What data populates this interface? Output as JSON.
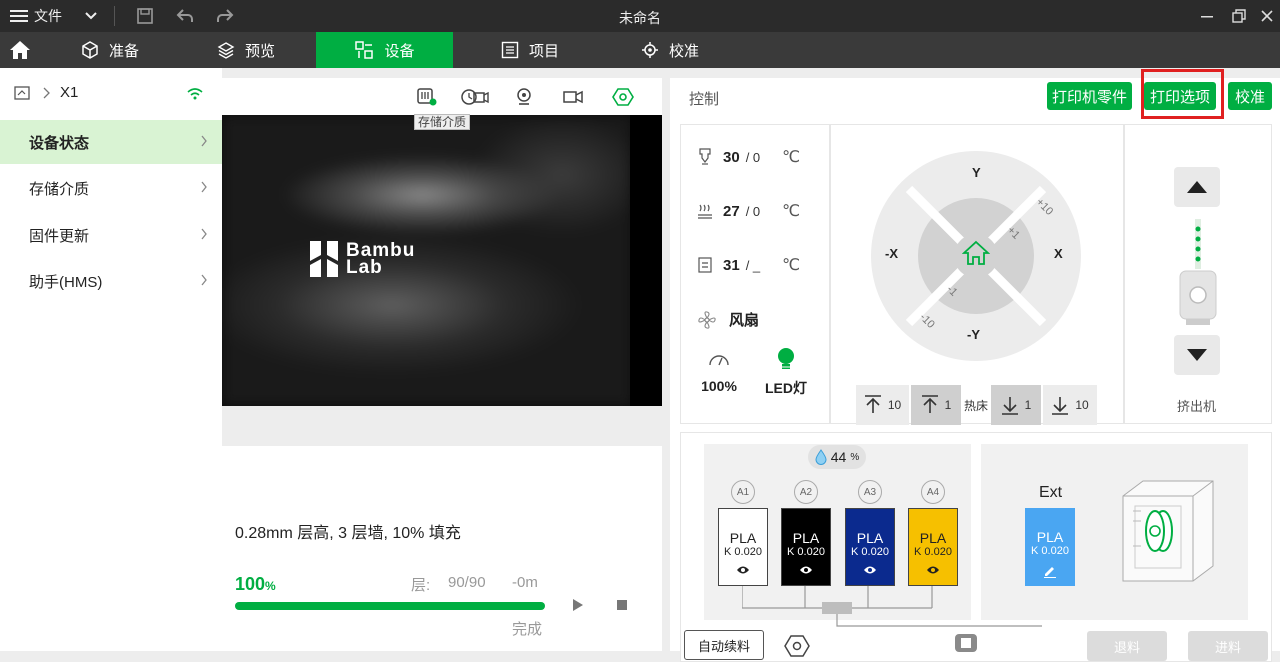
{
  "titlebar": {
    "menu_label": "文件",
    "title": "未命名"
  },
  "tabs": [
    {
      "label": "准备",
      "icon": "cube-icon"
    },
    {
      "label": "预览",
      "icon": "layers-icon"
    },
    {
      "label": "设备",
      "icon": "device-icon",
      "active": true
    },
    {
      "label": "项目",
      "icon": "list-icon"
    },
    {
      "label": "校准",
      "icon": "calibrate-icon"
    }
  ],
  "sidebar": {
    "printer_name": "X1",
    "items": [
      {
        "label": "设备状态",
        "active": true
      },
      {
        "label": "存储介质"
      },
      {
        "label": "固件更新"
      },
      {
        "label": "助手(HMS)"
      }
    ]
  },
  "camera": {
    "tooltip": "存储介质",
    "logo_line1": "Bambu",
    "logo_line2": "Lab"
  },
  "job": {
    "summary": "0.28mm 层高, 3 层墙, 10% 填充",
    "percent": "100",
    "percent_unit": "%",
    "progress": 1.0,
    "layer_label": "层:",
    "layers": "90/90",
    "time_left": "-0m",
    "status": "完成"
  },
  "control": {
    "title": "控制",
    "btn_parts": "打印机零件",
    "btn_options": "打印选项",
    "btn_calibrate": "校准",
    "nozzle_temp": "30",
    "nozzle_target": "/ 0",
    "bed_temp": "27",
    "bed_target": "/ 0",
    "chamber_temp": "31",
    "chamber_target": "/ _",
    "unit": "℃",
    "fan_label": "风扇",
    "speed": "100%",
    "led_label": "LED灯",
    "axis_y": "Y",
    "axis_neg_y": "-Y",
    "axis_x": "X",
    "axis_neg_x": "-X",
    "step_p10": "+10",
    "step_p1": "+1",
    "step_m1": "-1",
    "step_m10": "-10",
    "bed_up10": "10",
    "bed_up1": "1",
    "bed_label": "热床",
    "bed_down1": "1",
    "bed_down10": "10",
    "extruder_label": "挤出机"
  },
  "ams": {
    "humidity": "44",
    "humidity_unit": "%",
    "slots": [
      {
        "id": "A1",
        "type": "PLA",
        "k": "K 0.020",
        "color": "#ffffff"
      },
      {
        "id": "A2",
        "type": "PLA",
        "k": "K 0.020",
        "color": "#000000"
      },
      {
        "id": "A3",
        "type": "PLA",
        "k": "K 0.020",
        "color": "#0b2a8e"
      },
      {
        "id": "A4",
        "type": "PLA",
        "k": "K 0.020",
        "color": "#f6c000"
      }
    ],
    "ext_label": "Ext",
    "ext_slot": {
      "type": "PLA",
      "k": "K 0.020",
      "color": "#4aa6f2"
    },
    "auto_refill": "自动续料",
    "unload": "退料",
    "load": "进料"
  },
  "colors": {
    "accent": "#00ae42",
    "highlight": "#e02020"
  }
}
